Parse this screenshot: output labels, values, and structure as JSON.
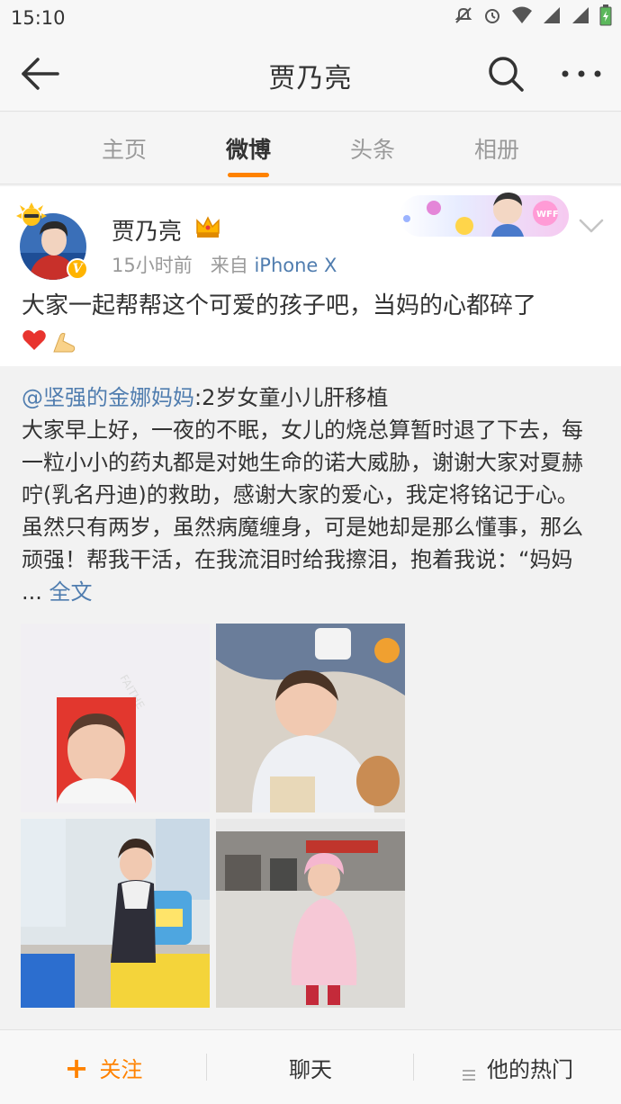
{
  "status_bar": {
    "time": "15:10"
  },
  "nav": {
    "title": "贾乃亮"
  },
  "tabs": [
    {
      "label": "主页",
      "active": false
    },
    {
      "label": "微博",
      "active": true
    },
    {
      "label": "头条",
      "active": false
    },
    {
      "label": "相册",
      "active": false
    }
  ],
  "post": {
    "author": "贾乃亮",
    "time": "15小时前",
    "from_label": "来自",
    "source": "iPhone X",
    "text": "大家一起帮帮这个可爱的孩子吧，当妈的心都碎了"
  },
  "repost": {
    "mention": "@坚强的金娜妈妈",
    "title_suffix": ":2岁女童小儿肝移植",
    "body": "大家早上好，一夜的不眠，女儿的烧总算暂时退了下去，每一粒小小的药丸都是对她生命的诺大威胁，谢谢大家对夏赫咛(乳名丹迪)的救助，感谢大家的爱心，我定将铭记于心。虽然只有两岁，虽然病魔缠身，可是她却是那么懂事，那么顽强！帮我干活，在我流泪时给我擦泪，抱着我说：“妈妈 ...",
    "more_link": "全文"
  },
  "bottom_bar": {
    "follow": "关注",
    "chat": "聊天",
    "hot": "他的热门"
  },
  "colors": {
    "accent": "#ff8200",
    "link": "#507daf"
  }
}
